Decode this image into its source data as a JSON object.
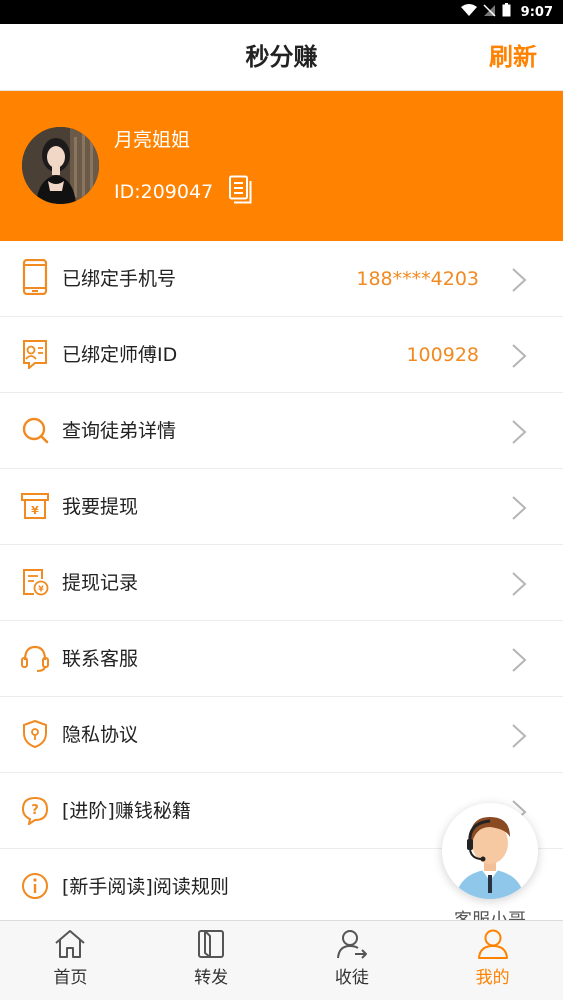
{
  "status_bar": {
    "time": "9:07"
  },
  "header": {
    "title": "秒分赚",
    "refresh_label": "刷新"
  },
  "profile": {
    "name": "月亮姐姐",
    "id_text": "ID:209047"
  },
  "menu": [
    {
      "label": "已绑定手机号",
      "value": "188****4203",
      "icon": "phone-icon"
    },
    {
      "label": "已绑定师傅ID",
      "value": "100928",
      "icon": "master-id-icon"
    },
    {
      "label": "查询徒弟详情",
      "value": "",
      "icon": "search-icon"
    },
    {
      "label": "我要提现",
      "value": "",
      "icon": "withdraw-icon"
    },
    {
      "label": "提现记录",
      "value": "",
      "icon": "withdraw-record-icon"
    },
    {
      "label": "联系客服",
      "value": "",
      "icon": "headset-icon"
    },
    {
      "label": "隐私协议",
      "value": "",
      "icon": "shield-icon"
    },
    {
      "label": "[进阶]赚钱秘籍",
      "value": "",
      "icon": "question-bubble-icon"
    },
    {
      "label": "[新手阅读]阅读规则",
      "value": "",
      "icon": "info-icon"
    }
  ],
  "floating_service": {
    "label": "客服小哥"
  },
  "tabbar": {
    "tabs": [
      {
        "label": "首页",
        "icon": "home-icon",
        "active": false
      },
      {
        "label": "转发",
        "icon": "book-icon",
        "active": false
      },
      {
        "label": "收徒",
        "icon": "user-add-icon",
        "active": false
      },
      {
        "label": "我的",
        "icon": "user-icon",
        "active": true
      }
    ]
  },
  "colors": {
    "accent": "#ff8200",
    "value_text": "#f08a21"
  }
}
